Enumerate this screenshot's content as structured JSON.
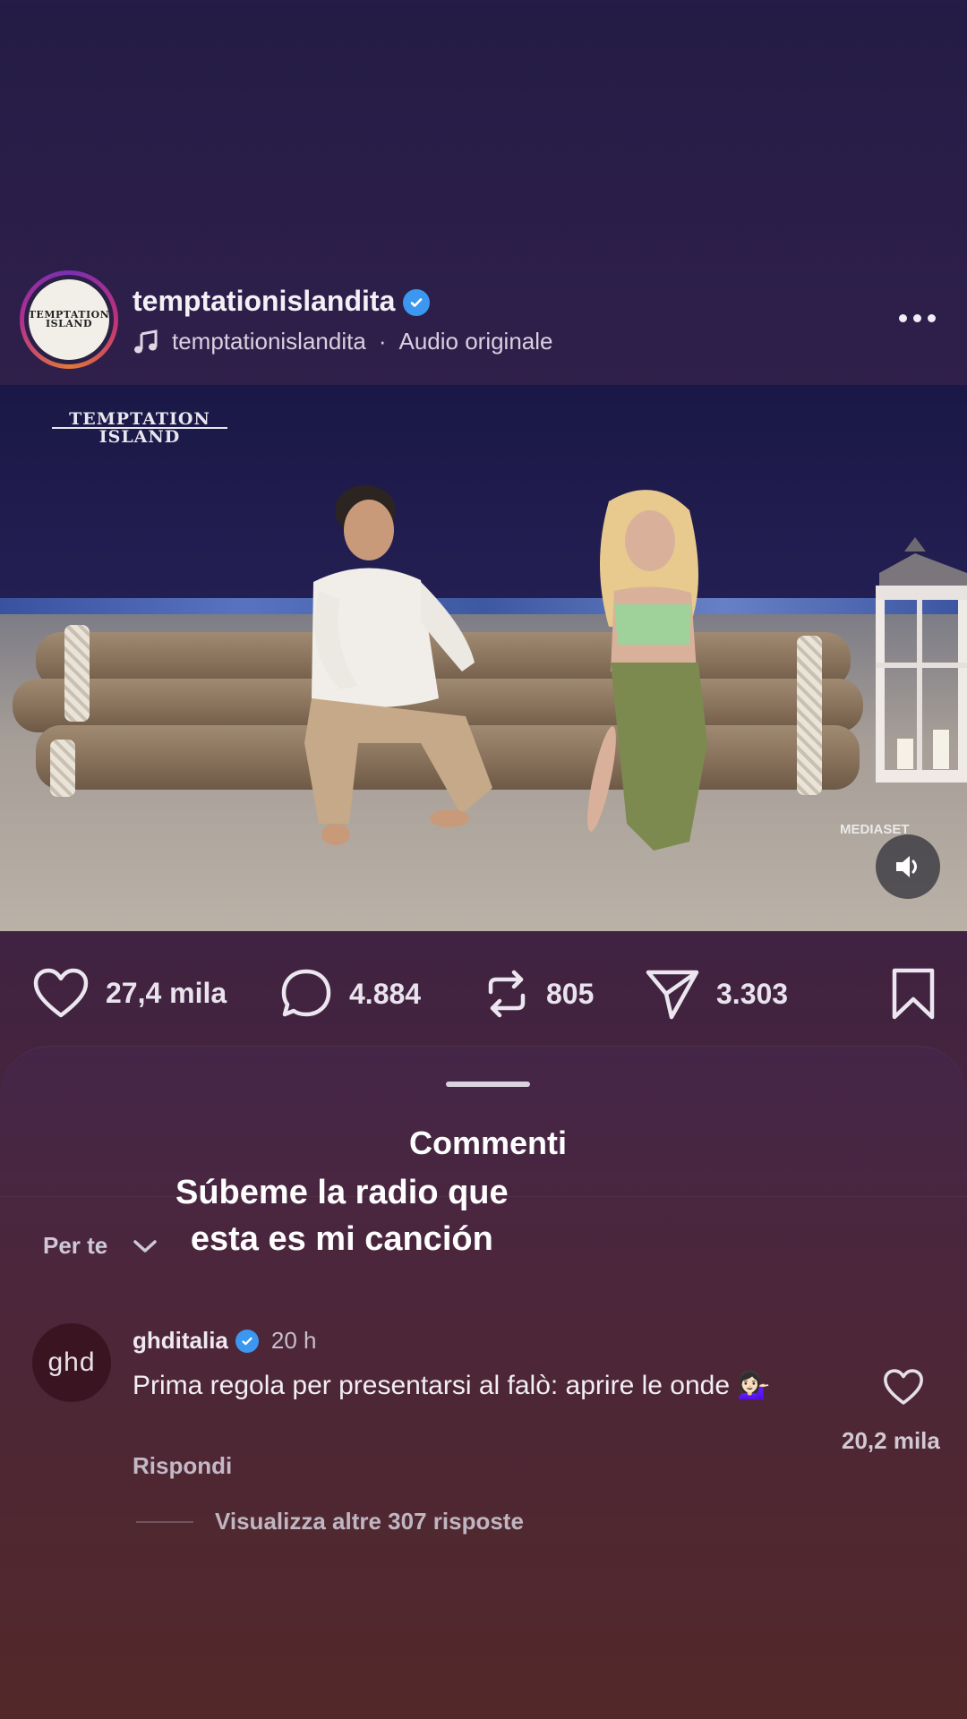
{
  "post": {
    "username": "temptationislandita",
    "audio_user": "temptationislandita",
    "audio_separator": "·",
    "audio_label": "Audio originale",
    "avatar_text": "TEMPTATION ISLAND",
    "video_logo_line1": "TEMPTATION",
    "video_logo_line2": "ISLAND",
    "watermark": "MEDIASET"
  },
  "actions": {
    "likes": "27,4 mila",
    "comments": "4.884",
    "reposts": "805",
    "shares": "3.303"
  },
  "comments_sheet": {
    "title": "Commenti",
    "sort_label": "Per te",
    "caption_line1": "Súbeme la radio que",
    "caption_line2": "esta es mi canción"
  },
  "comment": {
    "avatar_text": "ghd",
    "username": "ghditalia",
    "time": "20 h",
    "text": "Prima regola per presentarsi al falò: aprire le onde 💁🏻‍♀️",
    "reply_label": "Rispondi",
    "like_count": "20,2 mila",
    "more_replies": "Visualizza altre 307 risposte"
  },
  "colors": {
    "verified": "#3b97f0",
    "background_top": "#241c46",
    "background_bottom": "#552a28"
  }
}
